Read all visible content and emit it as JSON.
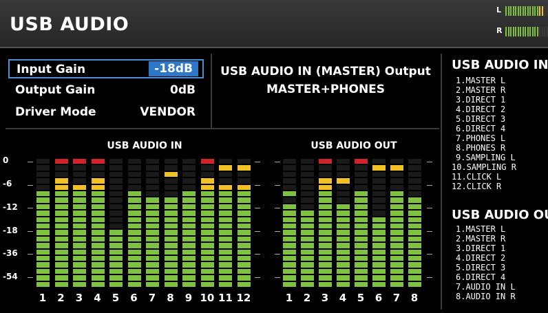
{
  "header": {
    "title": "USB AUDIO"
  },
  "level_meter": {
    "left_label": "L",
    "right_label": "R",
    "left_level": 0.9,
    "right_level": 0.75,
    "colors": {
      "green": "#7fc241",
      "yellow": "#f2c224",
      "red": "#d2222a",
      "off": "#3a3a3a"
    }
  },
  "params": [
    {
      "label": "Input Gain",
      "value": "-18dB",
      "selected": true
    },
    {
      "label": "Output Gain",
      "value": "0dB",
      "selected": false
    },
    {
      "label": "Driver Mode",
      "value": "VENDOR",
      "selected": false
    }
  ],
  "output_routing": {
    "line1": "USB AUDIO IN (MASTER) Output",
    "line2": "MASTER+PHONES"
  },
  "meters": {
    "scale": [
      "0",
      "-6",
      "-12",
      "-18",
      "-36",
      "-54"
    ],
    "total_segments": 20,
    "usb_in": {
      "title": "USB AUDIO IN",
      "channels": [
        "1",
        "2",
        "3",
        "4",
        "5",
        "6",
        "7",
        "8",
        "9",
        "10",
        "11",
        "12"
      ],
      "levels": [
        15,
        17,
        16,
        17,
        9,
        15,
        14,
        14,
        15,
        17,
        16,
        16
      ],
      "peaks": [
        null,
        19,
        19,
        19,
        null,
        null,
        null,
        17,
        null,
        19,
        18,
        18
      ]
    },
    "usb_out": {
      "title": "USB AUDIO OUT",
      "channels": [
        "1",
        "2",
        "3",
        "4",
        "5",
        "6",
        "7",
        "8"
      ],
      "levels": [
        13,
        12,
        17,
        13,
        15,
        11,
        15,
        14
      ],
      "peaks": [
        14,
        null,
        19,
        16,
        19,
        18,
        18,
        null
      ]
    },
    "colors": {
      "green": "#7fc241",
      "yellow": "#f2c224",
      "red": "#d2222a",
      "off": "#1a1a1a"
    }
  },
  "usb_audio_in_list": {
    "title": "USB AUDIO IN",
    "items": [
      "1.MASTER L",
      "2.MASTER R",
      "3.DIRECT 1",
      "4.DIRECT 2",
      "5.DIRECT 3",
      "6.DIRECT 4",
      "7.PHONES L",
      "8.PHONES R",
      "9.SAMPLING L",
      "10.SAMPLING R",
      "11.CLICK L",
      "12.CLICK R"
    ]
  },
  "usb_audio_out_list": {
    "title": "USB AUDIO OUT",
    "items": [
      "1.MASTER L",
      "2.MASTER R",
      "3.DIRECT 1",
      "4.DIRECT 2",
      "5.DIRECT 3",
      "6.DIRECT 4",
      "7.AUDIO IN L",
      "8.AUDIO IN R"
    ]
  }
}
